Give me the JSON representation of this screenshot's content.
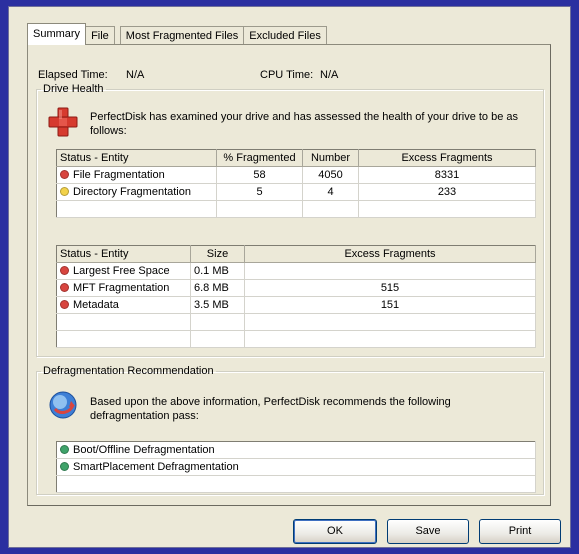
{
  "tabs": [
    "Summary",
    "File",
    "Most Fragmented Files",
    "Excluded Files"
  ],
  "elapsed": {
    "label": "Elapsed Time:",
    "value": "N/A"
  },
  "cpu": {
    "label": "CPU Time:",
    "value": "N/A"
  },
  "drive_health": {
    "legend": "Drive Health",
    "message": "PerfectDisk has examined your drive and has assessed the health of your drive to be as follows:",
    "table1": {
      "headers": [
        "Status - Entity",
        "% Fragmented",
        "Number",
        "Excess Fragments"
      ],
      "rows": [
        {
          "status_color": "#d8453f",
          "entity": "File Fragmentation",
          "pct": "58",
          "number": "4050",
          "excess": "8331"
        },
        {
          "status_color": "#f2d24a",
          "entity": "Directory Fragmentation",
          "pct": "5",
          "number": "4",
          "excess": "233"
        }
      ]
    },
    "table2": {
      "headers": [
        "Status - Entity",
        "Size",
        "Excess Fragments"
      ],
      "rows": [
        {
          "status_color": "#d8453f",
          "entity": "Largest Free Space",
          "size": "0.1 MB",
          "excess": ""
        },
        {
          "status_color": "#d8453f",
          "entity": "MFT Fragmentation",
          "size": "6.8 MB",
          "excess": "515"
        },
        {
          "status_color": "#d8453f",
          "entity": "Metadata",
          "size": "3.5 MB",
          "excess": "151"
        }
      ]
    }
  },
  "recommendation": {
    "legend": "Defragmentation Recommendation",
    "message": "Based upon the above information, PerfectDisk recommends the following defragmentation pass:",
    "items": [
      {
        "status_color": "#3fa36a",
        "label": "Boot/Offline Defragmentation"
      },
      {
        "status_color": "#3fa36a",
        "label": "SmartPlacement Defragmentation"
      }
    ]
  },
  "buttons": {
    "ok": "OK",
    "save": "Save",
    "print": "Print"
  },
  "icons": {
    "health": "health-cross-icon",
    "recommend": "defrag-advice-icon"
  }
}
